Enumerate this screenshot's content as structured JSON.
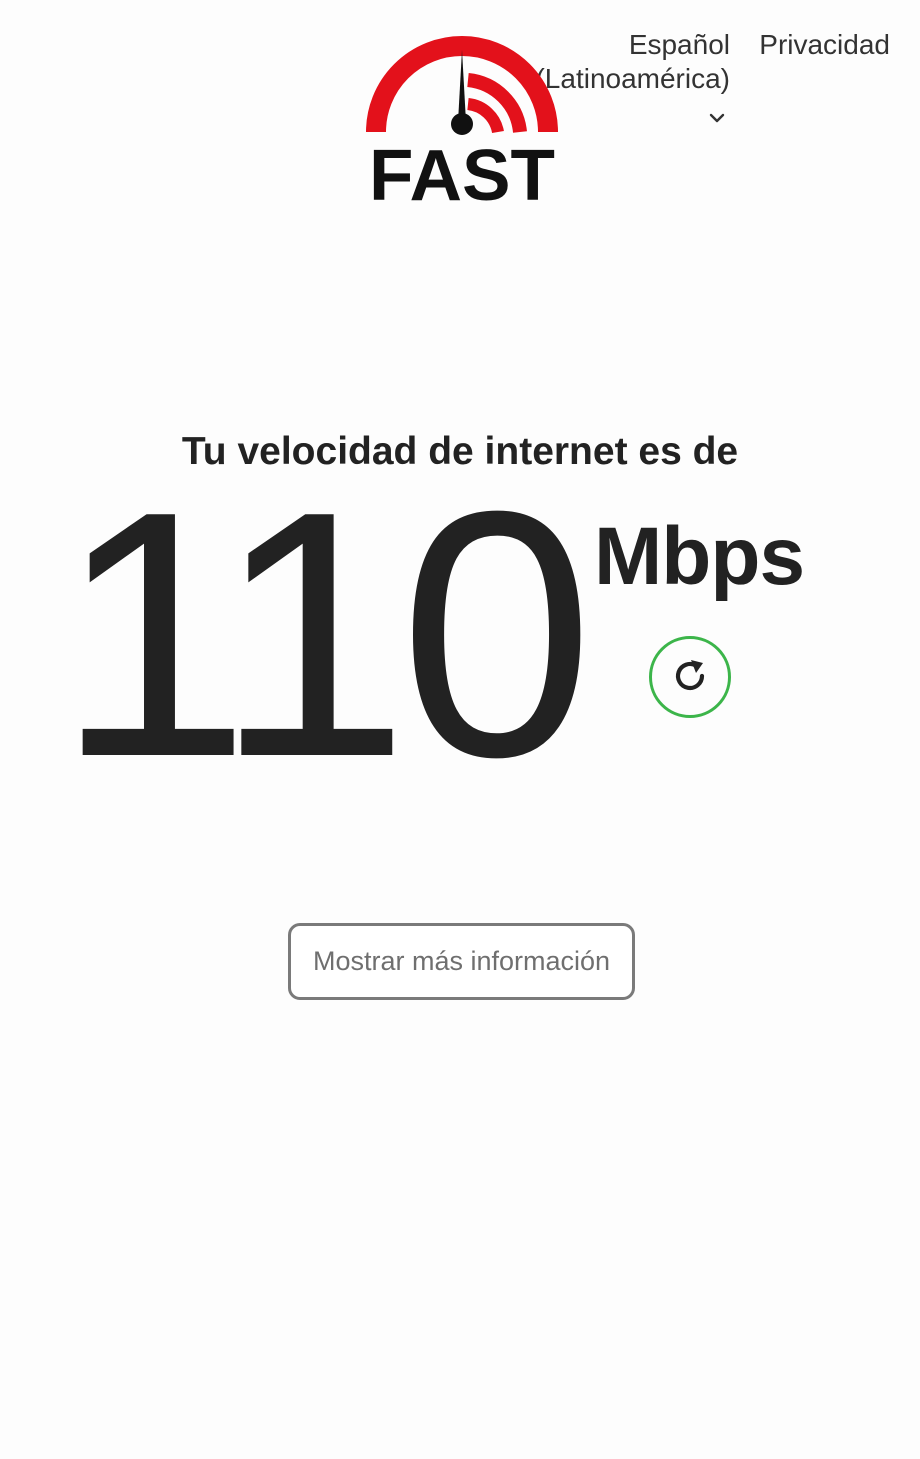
{
  "header": {
    "language": {
      "label": "Español (Latinoamérica)",
      "icon": "chevron-down-icon"
    },
    "privacy_label": "Privacidad"
  },
  "logo": {
    "text": "FAST",
    "icon": "speedometer-icon",
    "colors": {
      "arc": "#e3111b",
      "needle": "#111111",
      "text": "#111111"
    }
  },
  "result": {
    "headline": "Tu velocidad de internet es de",
    "speed_value": "110",
    "speed_units": "Mbps",
    "refresh_icon": "refresh-icon"
  },
  "more_info_label": "Mostrar más información",
  "colors": {
    "accent_green": "#3cb54a",
    "text": "#222222",
    "button_border": "#7a7a7a"
  }
}
